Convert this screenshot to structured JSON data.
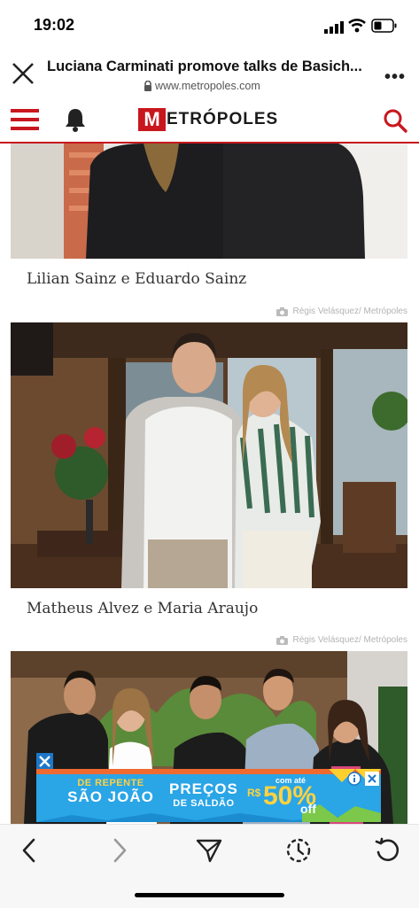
{
  "status": {
    "time": "19:02"
  },
  "browser": {
    "title": "Luciana Carminati promove talks de Basich...",
    "url": "www.metropoles.com",
    "more": "•••"
  },
  "site": {
    "logo_letter": "M",
    "logo_text": "ETRÓPOLES",
    "accent": "#c8171e"
  },
  "gallery": [
    {
      "caption": "Lilian Sainz e Eduardo Sainz",
      "credit": ""
    },
    {
      "caption": "Matheus Alvez e Maria Araujo",
      "credit": "Régis Velásquez/ Metrópoles"
    },
    {
      "caption": "",
      "credit": "Régis Velásquez/ Metrópoles"
    }
  ],
  "ad": {
    "headline_left_1": "DE REPENTE",
    "headline_left_2": "SÃO JOÃO",
    "headline_mid_1": "PREÇOS",
    "headline_mid_2": "DE SALDÃO",
    "price_prefix": "com até",
    "price_currency": "R$",
    "price_value": "50%",
    "price_suffix": "off"
  },
  "icons": [
    "close-icon",
    "lock-icon",
    "more-icon",
    "menu-icon",
    "bell-icon",
    "search-icon",
    "camera-icon",
    "back-icon",
    "forward-icon",
    "share-icon",
    "history-icon",
    "reload-icon",
    "info-icon"
  ]
}
